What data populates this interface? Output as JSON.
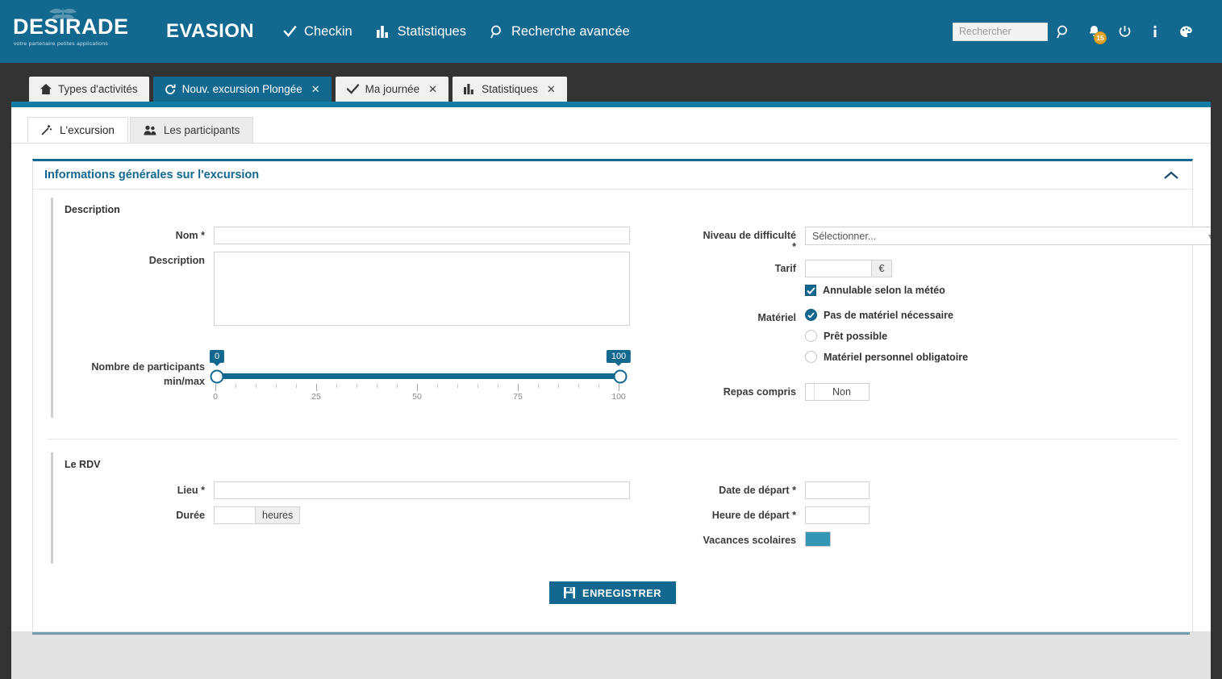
{
  "header": {
    "logo_word": "DESIRADE",
    "logo_tagline": "votre partenaire petites applications",
    "brand": "EVASION",
    "nav": [
      {
        "label": "Checkin",
        "icon": "check-icon"
      },
      {
        "label": "Statistiques",
        "icon": "bar-chart-icon"
      },
      {
        "label": "Recherche avancée",
        "icon": "search-icon"
      }
    ],
    "search_placeholder": "Rechercher",
    "search_value": "",
    "icons": {
      "search": "search-icon",
      "notifications": "bell-icon",
      "power": "power-icon",
      "info": "info-icon",
      "theme": "palette-icon"
    },
    "notification_count": "15",
    "accent_color": "#12688f",
    "badge_color": "#e0a526"
  },
  "tabs": [
    {
      "label": "Types d'activités",
      "icon": "home-icon",
      "active": false,
      "closable": false
    },
    {
      "label": "Nouv. excursion Plongée",
      "icon": "refresh-icon",
      "active": true,
      "closable": true,
      "close_label": "✕"
    },
    {
      "label": "Ma journée",
      "icon": "check-icon",
      "active": false,
      "closable": true,
      "close_label": "✕"
    },
    {
      "label": "Statistiques",
      "icon": "bar-chart-icon",
      "active": false,
      "closable": true,
      "close_label": "✕"
    }
  ],
  "subtabs": [
    {
      "label": "L'excursion",
      "icon": "magic-wand-icon",
      "active": true
    },
    {
      "label": "Les participants",
      "icon": "users-icon",
      "active": false
    }
  ],
  "panel": {
    "title": "Informations générales sur l'excursion",
    "collapse_icon": "chevron-up-icon"
  },
  "description_section": {
    "legend": "Description",
    "nom_label": "Nom *",
    "nom_value": "",
    "description_label": "Description",
    "description_value": "",
    "niveau_label": "Niveau de difficulté *",
    "niveau_value": "Sélectionner...",
    "tarif_label": "Tarif",
    "tarif_value": "",
    "tarif_unit": "€",
    "meteo_label": "Annulable selon la météo",
    "meteo_checked": true,
    "materiel_label": "Matériel",
    "materiel_options": [
      {
        "label": "Pas de matériel nécessaire",
        "selected": true
      },
      {
        "label": "Prêt possible",
        "selected": false
      },
      {
        "label": "Matériel personnel obligatoire",
        "selected": false
      }
    ],
    "repas_label": "Repas compris",
    "repas_value": "Non",
    "participants_label_line1": "Nombre de participants",
    "participants_label_line2": "min/max"
  },
  "slider": {
    "min_value": "0",
    "max_value": "100",
    "range_min": 0,
    "range_max": 100,
    "tick_step": 5,
    "major_labels": [
      "0",
      "25",
      "50",
      "75",
      "100"
    ],
    "major_positions": [
      0,
      25,
      50,
      75,
      100
    ]
  },
  "rdv_section": {
    "legend": "Le RDV",
    "lieu_label": "Lieu *",
    "lieu_value": "",
    "duree_label": "Durée",
    "duree_value": "",
    "duree_unit": "heures",
    "date_label": "Date de départ *",
    "date_value": "",
    "heure_label": "Heure de départ *",
    "heure_value": "",
    "vacances_label": "Vacances scolaires",
    "vacances_color": "#3596b5"
  },
  "footer": {
    "save_label": "ENREGISTRER",
    "save_icon": "floppy-disk-icon"
  }
}
